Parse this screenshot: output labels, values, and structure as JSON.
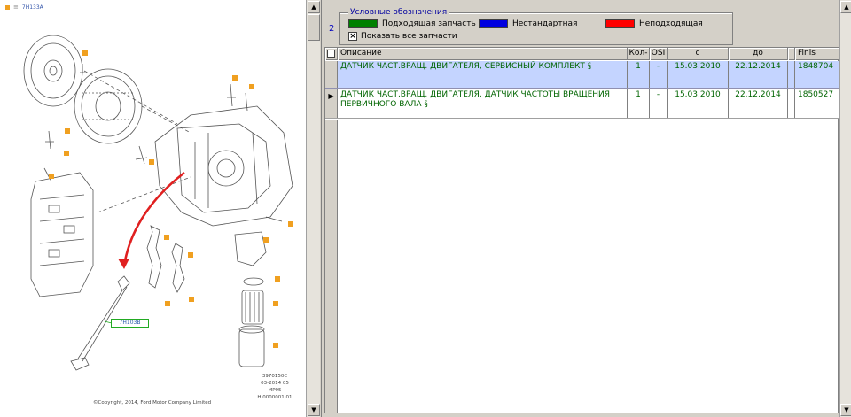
{
  "diagram": {
    "top_ref": "7H133A",
    "callout_label": "7H103B",
    "part_code_lines": [
      "3970150C",
      "03-2014 05",
      "MP95",
      "H 0000001 01"
    ],
    "copyright": "©Copyright, 2014, Ford Motor Company Limited"
  },
  "panel": {
    "row_number": "2",
    "legend": {
      "title": "Условные обозначения",
      "items": [
        {
          "label": "Подходящая запчасть",
          "color": "#008000"
        },
        {
          "label": "Нестандартная",
          "color": "#0000e0"
        },
        {
          "label": "Неподходящая",
          "color": "#ff0000"
        }
      ],
      "show_all_label": "Показать все запчасти",
      "show_all_checked": true
    }
  },
  "table": {
    "columns": [
      "Описание",
      "Кол-",
      "OSI",
      "с",
      "до",
      "",
      "Finis"
    ],
    "rows": [
      {
        "selected": true,
        "current": false,
        "description": "ДАТЧИК ЧАСТ.ВРАЩ. ДВИГАТЕЛЯ, СЕРВИСНЫЙ КОМПЛЕКТ §",
        "qty": "1",
        "osi": "-",
        "from": "15.03.2010",
        "to": "22.12.2014",
        "finis": "1848704"
      },
      {
        "selected": false,
        "current": true,
        "description": "ДАТЧИК ЧАСТ.ВРАЩ. ДВИГАТЕЛЯ, ДАТЧИК ЧАСТОТЫ ВРАЩЕНИЯ ПЕРВИЧНОГО ВАЛА §",
        "qty": "1",
        "osi": "-",
        "from": "15.03.2010",
        "to": "22.12.2014",
        "finis": "1850527"
      }
    ],
    "current_row_marker": "▶"
  },
  "colors": {
    "text_ok": "#006400",
    "selection": "#c4d4ff",
    "callout_arrow": "#e02020",
    "callout_marker": "#f0a020"
  }
}
